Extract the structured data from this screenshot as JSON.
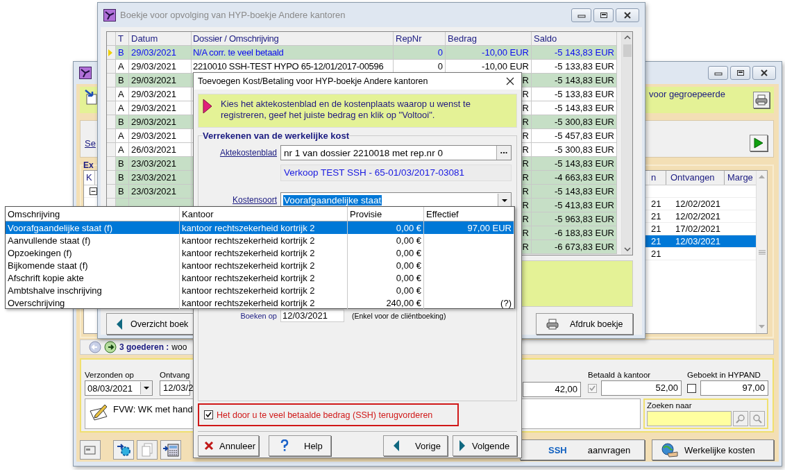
{
  "back_window": {
    "banner": {
      "text": "voor gegroepeerde"
    },
    "section": {
      "label": "Se"
    },
    "group": {
      "title": "Ex",
      "tree_expanded": true,
      "header_left": "K",
      "header_cut": "n",
      "columns": [
        "Ontvangen",
        "Marge"
      ],
      "rows": [
        {
          "column_1": "21",
          "ontvangen": "12/02/2021",
          "selected": false
        },
        {
          "column_1": "21",
          "ontvangen": "12/02/2021",
          "selected": false
        },
        {
          "column_1": "21",
          "ontvangen": "17/02/2021",
          "selected": false
        },
        {
          "column_1": "21",
          "ontvangen": "12/03/2021",
          "selected": true
        },
        {
          "column_1": "21",
          "selected": false
        }
      ]
    },
    "status": {
      "count": "3 goederen :",
      "text": "woo"
    },
    "details": {
      "sent_label": "Verzonden op",
      "sent_value": "08/03/2021",
      "received_label": "Ontvang",
      "received_value": "12/03/2",
      "amount": "42,00",
      "paid_label": "Betaald à kantoor",
      "paid_checked": true,
      "paid_disabled": true,
      "paid_value": "52,00",
      "booked_label": "Geboekt in HYPAND",
      "booked_checked": false,
      "booked_value": "97,00",
      "memo": "FVW: WK met hand",
      "search_label": "Zoeken naar"
    },
    "toolbar": {
      "ssh_button": {
        "tag": "SSH",
        "label": "aanvragen"
      },
      "costs_button": "Werkelijke kosten"
    }
  },
  "ledger_window": {
    "title": "Boekje voor opvolging van HYP-boekje Andere kantoren",
    "active": false,
    "columns": [
      "T",
      "Datum",
      "Dossier / Omschrijving",
      "RepNr",
      "Bedrag",
      "Saldo"
    ],
    "rows": [
      {
        "current": true,
        "highlighted": true,
        "t": "B",
        "datum": "29/03/2021",
        "omschrijving": "N/A corr. te veel betaald",
        "repnr": "0",
        "bedrag": "-10,00 EUR",
        "saldo": "-5 143,83 EUR"
      },
      {
        "current": false,
        "highlighted": false,
        "t": "A",
        "datum": "29/03/2021",
        "omschrijving": "2210010 SSH-TEST HYPO 65-12/01/2017-00596",
        "repnr": "0",
        "bedrag": "-10,00 EUR",
        "saldo": "-5 133,83 EUR"
      },
      {
        "current": false,
        "highlighted": true,
        "t": "B",
        "datum": "29/03/2021",
        "bedrag": "R",
        "saldo": "-5 143,83 EUR"
      },
      {
        "current": false,
        "highlighted": false,
        "t": "A",
        "datum": "29/03/2021",
        "bedrag": "R",
        "saldo": "-5 133,83 EUR"
      },
      {
        "current": false,
        "highlighted": false,
        "t": "A",
        "datum": "29/03/2021",
        "bedrag": "R",
        "saldo": "-5 143,83 EUR"
      },
      {
        "current": false,
        "highlighted": true,
        "t": "B",
        "datum": "29/03/2021",
        "bedrag": "R",
        "saldo": "-5 300,83 EUR"
      },
      {
        "current": false,
        "highlighted": false,
        "t": "A",
        "datum": "29/03/2021",
        "bedrag": "R",
        "saldo": "-5 457,83 EUR"
      },
      {
        "current": false,
        "highlighted": false,
        "t": "A",
        "datum": "26/03/2021",
        "bedrag": "R",
        "saldo": "-5 300,83 EUR"
      },
      {
        "current": false,
        "highlighted": true,
        "t": "B",
        "datum": "23/03/2021",
        "bedrag": "R",
        "saldo": "-5 143,83 EUR"
      },
      {
        "current": false,
        "highlighted": true,
        "t": "B",
        "datum": "23/03/2021",
        "bedrag": "R",
        "saldo": "-4 663,83 EUR"
      },
      {
        "current": false,
        "highlighted": true,
        "t": "B",
        "datum": "23/03/2021",
        "bedrag": "R",
        "saldo": "-5 143,83 EUR"
      },
      {
        "current": false,
        "highlighted": true,
        "bedrag": "R",
        "saldo": "-5 413,83 EUR"
      },
      {
        "current": false,
        "highlighted": true,
        "bedrag": "R",
        "saldo": "-5 963,83 EUR"
      },
      {
        "current": false,
        "highlighted": true,
        "bedrag": "R",
        "saldo": "-6 183,83 EUR"
      },
      {
        "current": false,
        "highlighted": true,
        "bedrag": "R",
        "saldo": "-6 673,83 EUR"
      }
    ],
    "buttons": [
      "Overzicht boek",
      "Afdruk boekje"
    ]
  },
  "dialog": {
    "title": "Toevoegen Kost/Betaling voor HYP-boekje Andere kantoren",
    "instruction": "Kies het aktekostenblad en de kostenplaats waarop u wenst te registreren, geef het juiste bedrag en klik op \"Voltooi\".",
    "group_title": "Verrekenen van de werkelijke kost",
    "aktekostenblad_label": "Aktekostenblad",
    "aktekostenblad_value": "nr 1 van dossier 2210018 met rep.nr 0",
    "browse_button": "...",
    "dossier_info": "Verkoop TEST SSH - 65-01/03/2017-03081",
    "kostensoort_label": "Kostensoort",
    "kostensoort_value": "Voorafgaandelijke staat",
    "boeken_label": "Boeken op",
    "boeken_value": "12/03/2021",
    "boeken_hint": "(Enkel voor de cliëntboeking)",
    "reclaim": {
      "label": "Het door u te veel betaalde bedrag (SSH) terugvorderen",
      "checked": true
    },
    "buttons": [
      {
        "kind": "cancel",
        "label": "Annuleer"
      },
      {
        "kind": "help",
        "label": "Help"
      },
      {
        "kind": "back",
        "label": "Vorige"
      },
      {
        "kind": "next",
        "label": "Volgende"
      }
    ]
  },
  "dropdown": {
    "columns": [
      "Omschrijving",
      "Kantoor",
      "Provisie",
      "Effectief"
    ],
    "rows": [
      {
        "omschrijving": "Voorafgaandelijke staat (f)",
        "kantoor": "kantoor rechtszekerheid kortrijk 2",
        "provisie": "0,00 €",
        "effectief": "97,00 EUR",
        "selected": true
      },
      {
        "omschrijving": "Aanvullende staat (f)",
        "kantoor": "kantoor rechtszekerheid kortrijk 2",
        "provisie": "0,00 €",
        "selected": false
      },
      {
        "omschrijving": "Opzoekingen (f)",
        "kantoor": "kantoor rechtszekerheid kortrijk 2",
        "provisie": "0,00 €",
        "selected": false
      },
      {
        "omschrijving": "Bijkomende staat (f)",
        "kantoor": "kantoor rechtszekerheid kortrijk 2",
        "provisie": "0,00 €",
        "selected": false
      },
      {
        "omschrijving": "Afschrift kopie akte",
        "kantoor": "kantoor rechtszekerheid kortrijk 2",
        "provisie": "0,00 €",
        "selected": false
      },
      {
        "omschrijving": "Ambtshalve inschrijving",
        "kantoor": "kantoor rechtszekerheid kortrijk 2",
        "provisie": "0,00 €",
        "selected": false
      },
      {
        "omschrijving": "Overschrijving",
        "kantoor": "kantoor rechtszekerheid kortrijk 2",
        "provisie": "240,00 €",
        "effectief": "(?)",
        "selected": false
      }
    ]
  }
}
